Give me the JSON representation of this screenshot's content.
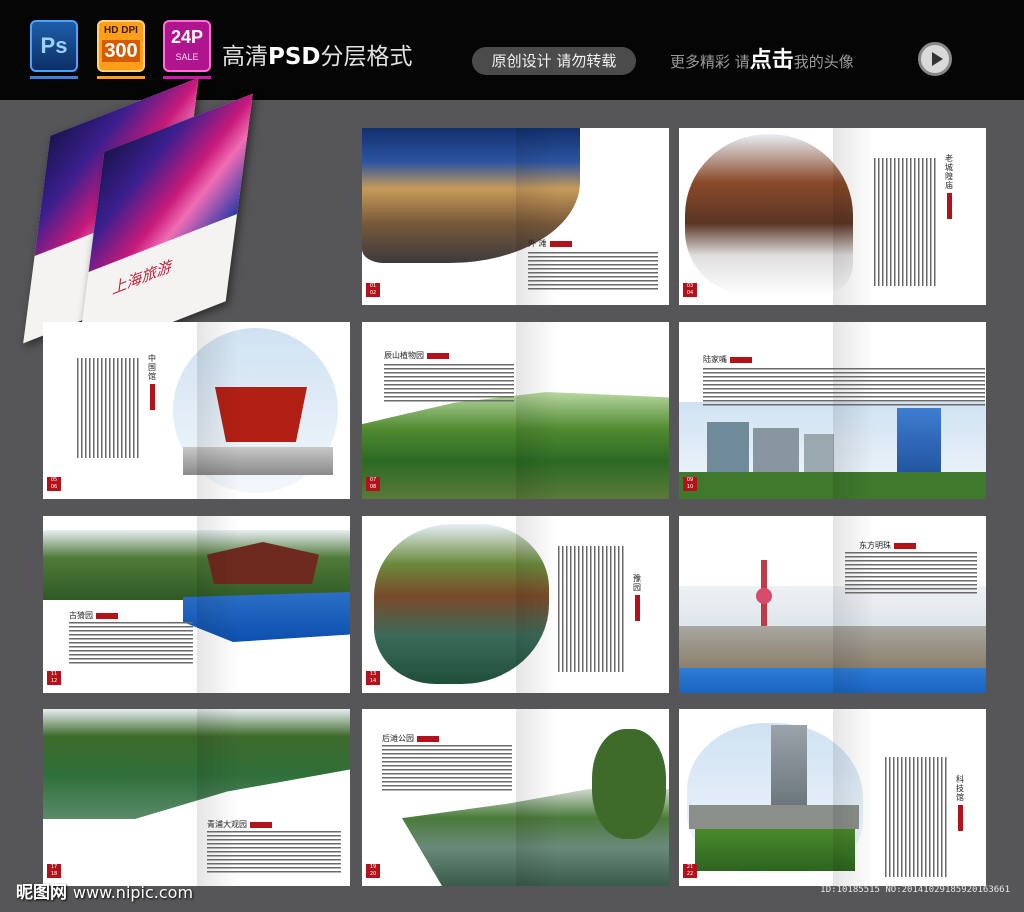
{
  "banner": {
    "ps_badge": "Ps",
    "hd_badge": {
      "top": "HD DPI",
      "value": "300"
    },
    "layers_badge": {
      "value": "24P",
      "sub": "SALE"
    },
    "title_prefix": "高清",
    "title_bold": "PSD",
    "title_suffix": "分层格式",
    "pill": "原创设计 请勿转载",
    "more_a": "更多精彩 请",
    "more_strong": "点击",
    "more_b": "我的头像"
  },
  "cover": {
    "title": "上海旅游"
  },
  "spreads": [
    {
      "heading": "外 滩",
      "pages": "01 02"
    },
    {
      "heading": "老城隍庙",
      "pages": "03 04"
    },
    {
      "heading": "中国馆",
      "pages": "05 06"
    },
    {
      "heading": "辰山植物园",
      "pages": "07 08"
    },
    {
      "heading": "陆家嘴",
      "pages": "09 10"
    },
    {
      "heading": "古猗园",
      "pages": "11 12"
    },
    {
      "heading": "豫 园",
      "pages": "13 14"
    },
    {
      "heading": "东方明珠",
      "pages": ""
    },
    {
      "heading": "青浦大观园",
      "pages": "17 18"
    },
    {
      "heading": "后滩公园",
      "pages": "19 20"
    },
    {
      "heading": "科技馆",
      "pages": "21 22"
    }
  ],
  "footer": {
    "site": "昵图网",
    "url": "www.nipic.com",
    "image_id": "ID:10185515 NO:20141029185920163661"
  },
  "colors": {
    "accent": "#b3121b",
    "banner_bg": "#050505",
    "page_bg": "#565658"
  }
}
